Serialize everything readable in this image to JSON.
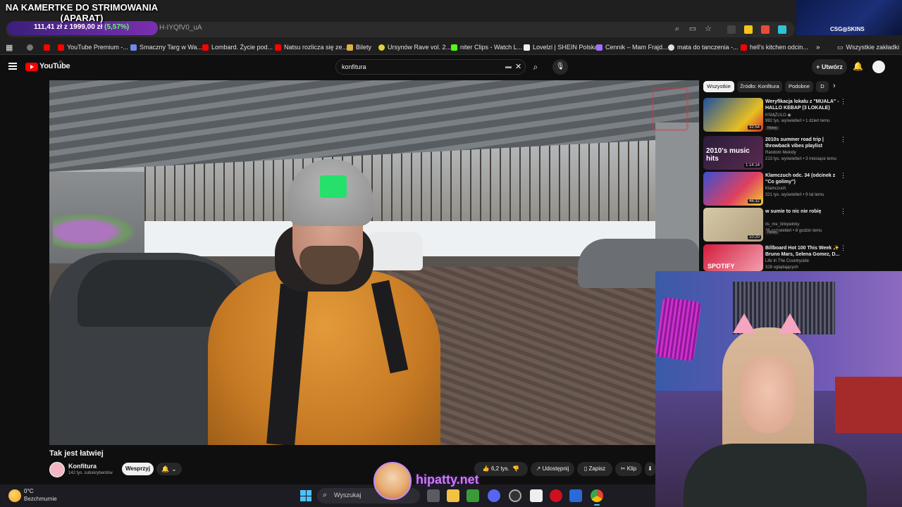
{
  "overlay": {
    "title_line1": "NA KAMERTKE DO STRIMOWANIA",
    "title_line2": "(APARAT)",
    "price_current": "111,41 zł",
    "price_sep": "z",
    "price_goal": "1999,00 zł",
    "price_pct": "(5,57%)",
    "sponsor": "CSG◎SKINS",
    "streamer_handle": "hipatty.net"
  },
  "browser": {
    "url_fragment": "H-IYQfV0_uA",
    "bookmarks": [
      {
        "label": "YouTube Premium -...",
        "color": "#ff0000"
      },
      {
        "label": "Smaczny Targ w Wa...",
        "color": "#6c8cf0"
      },
      {
        "label": "Lombard. Życie pod...",
        "color": "#ff0000"
      },
      {
        "label": "Natsu rozlicza się ze...",
        "color": "#ff0000"
      },
      {
        "label": "Bilety",
        "color": "#e0b040"
      },
      {
        "label": "Ursynów Rave vol. 2...",
        "color": "#e6d040"
      },
      {
        "label": "niter Clips - Watch L...",
        "color": "#53fc18"
      },
      {
        "label": "Lovelzi | SHEIN Polska",
        "color": "#f1f1f1"
      },
      {
        "label": "Cennik – Mam Frajd...",
        "color": "#a070ff"
      },
      {
        "label": "mata do tanczenia -...",
        "color": "#e0e0e0"
      },
      {
        "label": "hell's kitchen odcin...",
        "color": "#ff0000"
      }
    ],
    "all_bookmarks": "Wszystkie zakładki"
  },
  "youtube": {
    "logo_text": "YouTube",
    "region": "PL",
    "search_value": "konfitura",
    "create_label": "Utwórz",
    "video_title": "Tak jest łatwiej",
    "channel_name": "Konfitura",
    "channel_subs": "142 tys. subskrybentów",
    "support_label": "Wesprzyj",
    "likes": "6,2 tys.",
    "share_label": "Udostępnij",
    "save_label": "Zapisz",
    "clip_label": "Klip",
    "chips": [
      {
        "label": "Wszystkie",
        "active": true
      },
      {
        "label": "Źródło: Konfitura",
        "active": false
      },
      {
        "label": "Podobne",
        "active": false
      },
      {
        "label": "D",
        "active": false
      }
    ],
    "recommended": [
      {
        "title": "Weryfikacja lokalu z \"MUALA\" - HALLO KEBAP (3 LOKALE)",
        "channel": "KSIĄŻULO",
        "meta": "992 tys. wyświetleń • 1 dzień temu",
        "badge": "Nowy",
        "duration": "32:54",
        "thumb": "#1e4fa0"
      },
      {
        "title": "2010s summer road trip | throwback vibes playlist",
        "channel": "Random Melody",
        "meta": "213 tys. wyświetleń • 3 miesiące temu",
        "badge": "",
        "duration": "1:14:14",
        "thumb": "#2a1c3a",
        "thumb_text": "2010's music hits"
      },
      {
        "title": "Klamczuch odc. 34 (odcinek z \"Co golimy\")",
        "channel": "Klamczuch",
        "meta": "321 tys. wyświetleń • 9 lat temu",
        "badge": "",
        "duration": "46:32",
        "thumb": "#3a4fd0"
      },
      {
        "title": "w sumie to nic nie robię",
        "channel": "its_me_tinkywinky",
        "meta": "35 wyświetleń • 8 godzin temu",
        "badge": "Nowy",
        "duration": "10:20",
        "thumb": "#d6c9a8"
      },
      {
        "title": "Billboard Hot 100 This Week ✨ Bruno Mars, Selena Gomez, D...",
        "channel": "Life In The Countryside",
        "meta": "328 oglądających",
        "badge": "",
        "duration": "",
        "thumb": "#d41c3c",
        "thumb_text": "SPOTIFY"
      }
    ]
  },
  "taskbar": {
    "temp": "0°C",
    "weather": "Bezchmurnie",
    "search_placeholder": "Wyszukaj"
  }
}
